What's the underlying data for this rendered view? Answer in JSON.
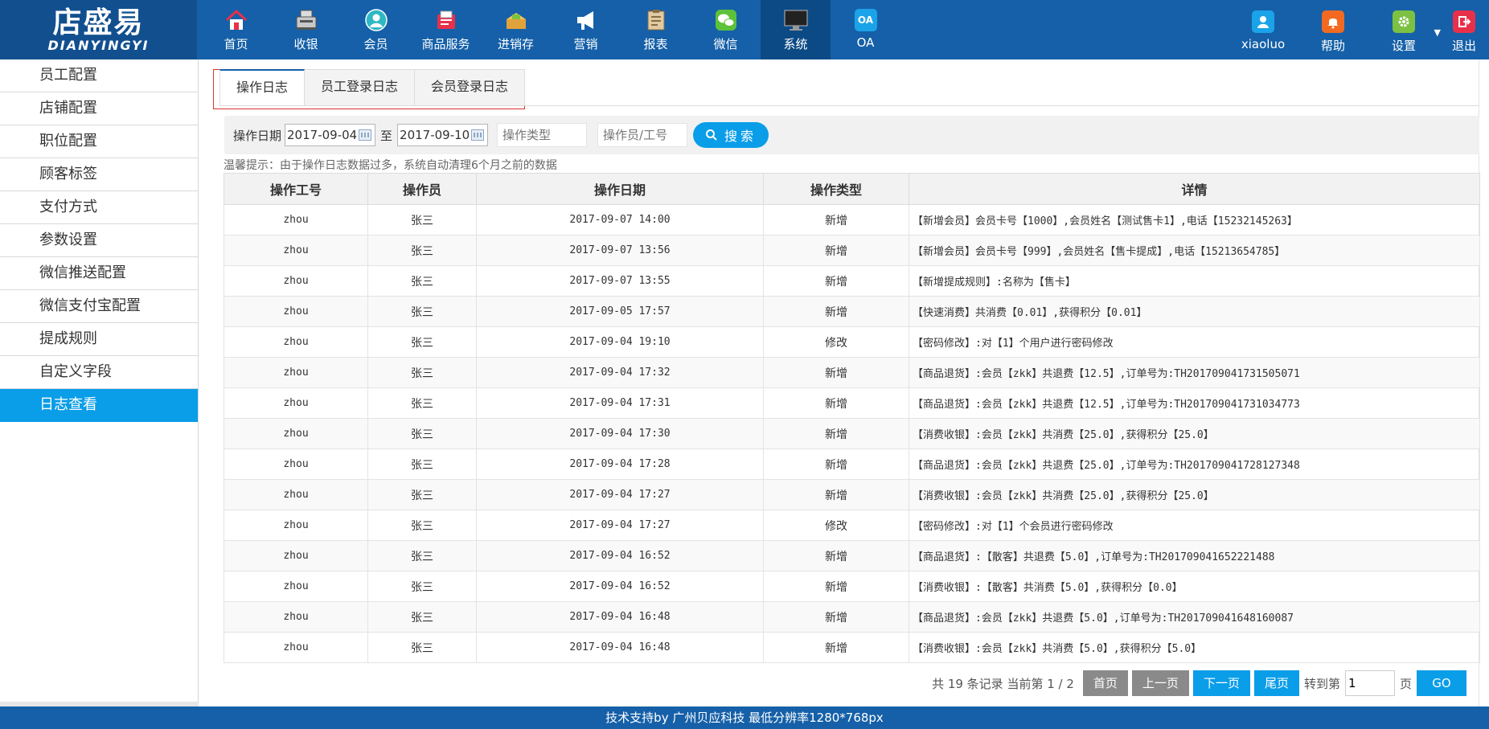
{
  "logo": {
    "main": "店盛易",
    "sub": "DIANYINGYI"
  },
  "nav": [
    {
      "label": "首页",
      "icon": "home-icon"
    },
    {
      "label": "收银",
      "icon": "cash-register-icon"
    },
    {
      "label": "会员",
      "icon": "member-icon"
    },
    {
      "label": "商品服务",
      "icon": "product-icon"
    },
    {
      "label": "进销存",
      "icon": "inventory-icon"
    },
    {
      "label": "营销",
      "icon": "megaphone-icon"
    },
    {
      "label": "报表",
      "icon": "report-icon"
    },
    {
      "label": "微信",
      "icon": "wechat-icon"
    },
    {
      "label": "系统",
      "icon": "monitor-icon"
    },
    {
      "label": "OA",
      "icon": "oa-icon",
      "icon_text": "OA"
    }
  ],
  "user_nav": [
    {
      "label": "xiaoluo",
      "icon": "user-icon",
      "color": "#1aa3e8"
    },
    {
      "label": "帮助",
      "icon": "bell-icon",
      "color": "#f26a21"
    },
    {
      "label": "设置",
      "icon": "gear-icon",
      "color": "#7cc142"
    },
    {
      "label": "退出",
      "icon": "logout-icon",
      "color": "#e8304a"
    }
  ],
  "sidebar": [
    "员工配置",
    "店铺配置",
    "职位配置",
    "顾客标签",
    "支付方式",
    "参数设置",
    "微信推送配置",
    "微信支付宝配置",
    "提成规则",
    "自定义字段",
    "日志查看"
  ],
  "tabs": [
    "操作日志",
    "员工登录日志",
    "会员登录日志"
  ],
  "filter": {
    "date_label": "操作日期",
    "date_from": "2017-09-04",
    "to_label": "至",
    "date_to": "2017-09-10",
    "type_placeholder": "操作类型",
    "operator_placeholder": "操作员/工号",
    "search_label": "搜索"
  },
  "tip": "温馨提示：由于操作日志数据过多，系统自动清理6个月之前的数据",
  "table": {
    "headers": [
      "操作工号",
      "操作员",
      "操作日期",
      "操作类型",
      "详情"
    ],
    "rows": [
      [
        "zhou",
        "张三",
        "2017-09-07 14:00",
        "新增",
        "【新增会员】会员卡号【1000】,会员姓名【测试售卡1】,电话【15232145263】"
      ],
      [
        "zhou",
        "张三",
        "2017-09-07 13:56",
        "新增",
        "【新增会员】会员卡号【999】,会员姓名【售卡提成】,电话【15213654785】"
      ],
      [
        "zhou",
        "张三",
        "2017-09-07 13:55",
        "新增",
        "【新增提成规则】:名称为【售卡】"
      ],
      [
        "zhou",
        "张三",
        "2017-09-05 17:57",
        "新增",
        "【快速消费】共消费【0.01】,获得积分【0.01】"
      ],
      [
        "zhou",
        "张三",
        "2017-09-04 19:10",
        "修改",
        "【密码修改】:对【1】个用户进行密码修改"
      ],
      [
        "zhou",
        "张三",
        "2017-09-04 17:32",
        "新增",
        "【商品退货】:会员【zkk】共退费【12.5】,订单号为:TH201709041731505071"
      ],
      [
        "zhou",
        "张三",
        "2017-09-04 17:31",
        "新增",
        "【商品退货】:会员【zkk】共退费【12.5】,订单号为:TH201709041731034773"
      ],
      [
        "zhou",
        "张三",
        "2017-09-04 17:30",
        "新增",
        "【消费收银】:会员【zkk】共消费【25.0】,获得积分【25.0】"
      ],
      [
        "zhou",
        "张三",
        "2017-09-04 17:28",
        "新增",
        "【商品退货】:会员【zkk】共退费【25.0】,订单号为:TH201709041728127348"
      ],
      [
        "zhou",
        "张三",
        "2017-09-04 17:27",
        "新增",
        "【消费收银】:会员【zkk】共消费【25.0】,获得积分【25.0】"
      ],
      [
        "zhou",
        "张三",
        "2017-09-04 17:27",
        "修改",
        "【密码修改】:对【1】个会员进行密码修改"
      ],
      [
        "zhou",
        "张三",
        "2017-09-04 16:52",
        "新增",
        "【商品退货】:【散客】共退费【5.0】,订单号为:TH201709041652221488"
      ],
      [
        "zhou",
        "张三",
        "2017-09-04 16:52",
        "新增",
        "【消费收银】:【散客】共消费【5.0】,获得积分【0.0】"
      ],
      [
        "zhou",
        "张三",
        "2017-09-04 16:48",
        "新增",
        "【商品退货】:会员【zkk】共退费【5.0】,订单号为:TH201709041648160087"
      ],
      [
        "zhou",
        "张三",
        "2017-09-04 16:48",
        "新增",
        "【消费收银】:会员【zkk】共消费【5.0】,获得积分【5.0】"
      ]
    ]
  },
  "pager": {
    "info": "共 19 条记录 当前第 1 / 2",
    "first": "首页",
    "prev": "上一页",
    "next": "下一页",
    "last": "尾页",
    "goto_label": "转到第",
    "page_value": "1",
    "page_suffix": "页",
    "go": "GO"
  },
  "footer": "技术支持by 广州贝应科技    最低分辨率1280*768px",
  "colors": {
    "topbar": "#1560a8",
    "accent": "#0a9de8",
    "highlight_border": "#d9322e"
  }
}
